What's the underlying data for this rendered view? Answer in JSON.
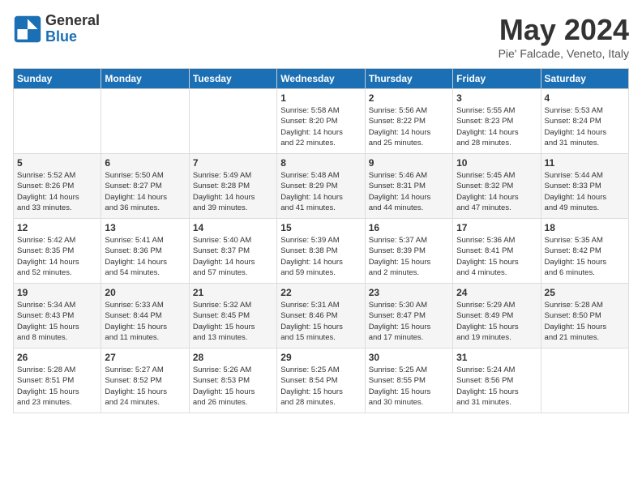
{
  "logo": {
    "line1": "General",
    "line2": "Blue"
  },
  "title": "May 2024",
  "subtitle": "Pie' Falcade, Veneto, Italy",
  "days_of_week": [
    "Sunday",
    "Monday",
    "Tuesday",
    "Wednesday",
    "Thursday",
    "Friday",
    "Saturday"
  ],
  "weeks": [
    [
      {
        "day": "",
        "info": ""
      },
      {
        "day": "",
        "info": ""
      },
      {
        "day": "",
        "info": ""
      },
      {
        "day": "1",
        "info": "Sunrise: 5:58 AM\nSunset: 8:20 PM\nDaylight: 14 hours\nand 22 minutes."
      },
      {
        "day": "2",
        "info": "Sunrise: 5:56 AM\nSunset: 8:22 PM\nDaylight: 14 hours\nand 25 minutes."
      },
      {
        "day": "3",
        "info": "Sunrise: 5:55 AM\nSunset: 8:23 PM\nDaylight: 14 hours\nand 28 minutes."
      },
      {
        "day": "4",
        "info": "Sunrise: 5:53 AM\nSunset: 8:24 PM\nDaylight: 14 hours\nand 31 minutes."
      }
    ],
    [
      {
        "day": "5",
        "info": "Sunrise: 5:52 AM\nSunset: 8:26 PM\nDaylight: 14 hours\nand 33 minutes."
      },
      {
        "day": "6",
        "info": "Sunrise: 5:50 AM\nSunset: 8:27 PM\nDaylight: 14 hours\nand 36 minutes."
      },
      {
        "day": "7",
        "info": "Sunrise: 5:49 AM\nSunset: 8:28 PM\nDaylight: 14 hours\nand 39 minutes."
      },
      {
        "day": "8",
        "info": "Sunrise: 5:48 AM\nSunset: 8:29 PM\nDaylight: 14 hours\nand 41 minutes."
      },
      {
        "day": "9",
        "info": "Sunrise: 5:46 AM\nSunset: 8:31 PM\nDaylight: 14 hours\nand 44 minutes."
      },
      {
        "day": "10",
        "info": "Sunrise: 5:45 AM\nSunset: 8:32 PM\nDaylight: 14 hours\nand 47 minutes."
      },
      {
        "day": "11",
        "info": "Sunrise: 5:44 AM\nSunset: 8:33 PM\nDaylight: 14 hours\nand 49 minutes."
      }
    ],
    [
      {
        "day": "12",
        "info": "Sunrise: 5:42 AM\nSunset: 8:35 PM\nDaylight: 14 hours\nand 52 minutes."
      },
      {
        "day": "13",
        "info": "Sunrise: 5:41 AM\nSunset: 8:36 PM\nDaylight: 14 hours\nand 54 minutes."
      },
      {
        "day": "14",
        "info": "Sunrise: 5:40 AM\nSunset: 8:37 PM\nDaylight: 14 hours\nand 57 minutes."
      },
      {
        "day": "15",
        "info": "Sunrise: 5:39 AM\nSunset: 8:38 PM\nDaylight: 14 hours\nand 59 minutes."
      },
      {
        "day": "16",
        "info": "Sunrise: 5:37 AM\nSunset: 8:39 PM\nDaylight: 15 hours\nand 2 minutes."
      },
      {
        "day": "17",
        "info": "Sunrise: 5:36 AM\nSunset: 8:41 PM\nDaylight: 15 hours\nand 4 minutes."
      },
      {
        "day": "18",
        "info": "Sunrise: 5:35 AM\nSunset: 8:42 PM\nDaylight: 15 hours\nand 6 minutes."
      }
    ],
    [
      {
        "day": "19",
        "info": "Sunrise: 5:34 AM\nSunset: 8:43 PM\nDaylight: 15 hours\nand 8 minutes."
      },
      {
        "day": "20",
        "info": "Sunrise: 5:33 AM\nSunset: 8:44 PM\nDaylight: 15 hours\nand 11 minutes."
      },
      {
        "day": "21",
        "info": "Sunrise: 5:32 AM\nSunset: 8:45 PM\nDaylight: 15 hours\nand 13 minutes."
      },
      {
        "day": "22",
        "info": "Sunrise: 5:31 AM\nSunset: 8:46 PM\nDaylight: 15 hours\nand 15 minutes."
      },
      {
        "day": "23",
        "info": "Sunrise: 5:30 AM\nSunset: 8:47 PM\nDaylight: 15 hours\nand 17 minutes."
      },
      {
        "day": "24",
        "info": "Sunrise: 5:29 AM\nSunset: 8:49 PM\nDaylight: 15 hours\nand 19 minutes."
      },
      {
        "day": "25",
        "info": "Sunrise: 5:28 AM\nSunset: 8:50 PM\nDaylight: 15 hours\nand 21 minutes."
      }
    ],
    [
      {
        "day": "26",
        "info": "Sunrise: 5:28 AM\nSunset: 8:51 PM\nDaylight: 15 hours\nand 23 minutes."
      },
      {
        "day": "27",
        "info": "Sunrise: 5:27 AM\nSunset: 8:52 PM\nDaylight: 15 hours\nand 24 minutes."
      },
      {
        "day": "28",
        "info": "Sunrise: 5:26 AM\nSunset: 8:53 PM\nDaylight: 15 hours\nand 26 minutes."
      },
      {
        "day": "29",
        "info": "Sunrise: 5:25 AM\nSunset: 8:54 PM\nDaylight: 15 hours\nand 28 minutes."
      },
      {
        "day": "30",
        "info": "Sunrise: 5:25 AM\nSunset: 8:55 PM\nDaylight: 15 hours\nand 30 minutes."
      },
      {
        "day": "31",
        "info": "Sunrise: 5:24 AM\nSunset: 8:56 PM\nDaylight: 15 hours\nand 31 minutes."
      },
      {
        "day": "",
        "info": ""
      }
    ]
  ]
}
